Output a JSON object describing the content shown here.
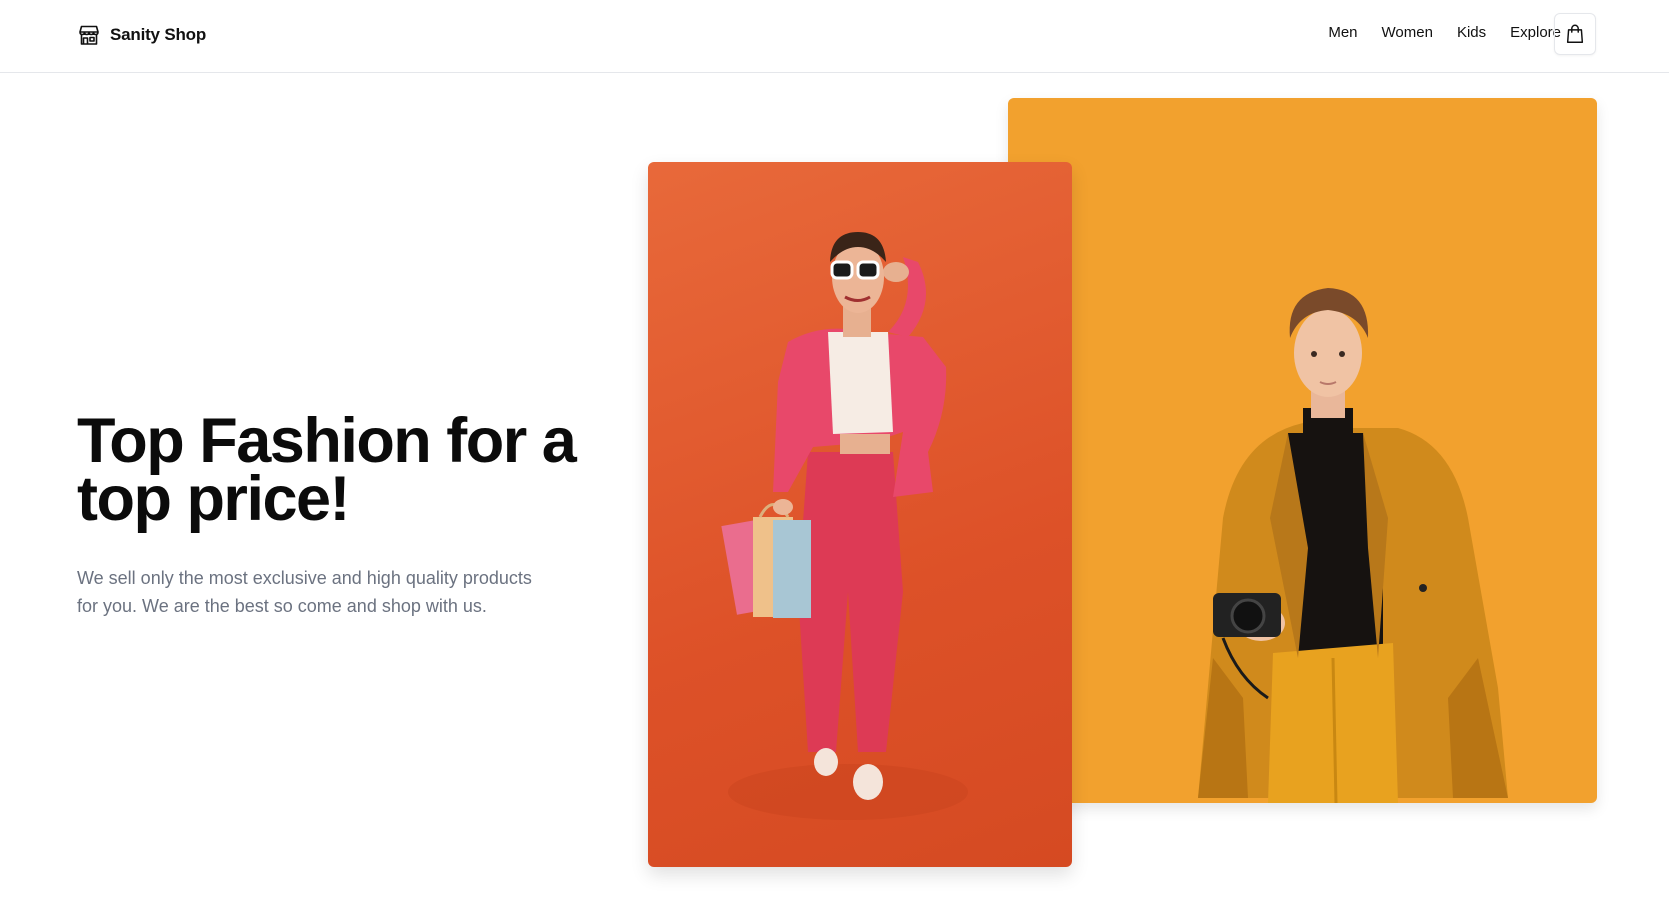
{
  "brand": {
    "name": "Sanity Shop",
    "icon": "storefront-icon"
  },
  "nav": {
    "items": [
      "Men",
      "Women",
      "Kids",
      "Explore"
    ]
  },
  "cart": {
    "icon": "shopping-bag-icon"
  },
  "hero": {
    "title": "Top Fashion for a top price!",
    "description": "We sell only the most exclusive and high quality products for you. We are the best so come and shop with us."
  },
  "colors": {
    "accent_orange": "#F2A12E",
    "accent_red_orange": "#DD5128",
    "text_muted": "#6B7280"
  }
}
